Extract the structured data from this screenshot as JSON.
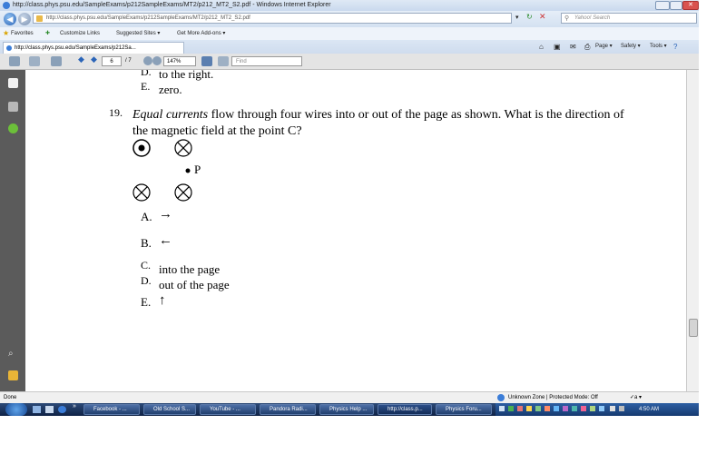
{
  "window": {
    "title": "http://class.phys.psu.edu/SampleExams/p212SampleExams/MT2/p212_MT2_S2.pdf - Windows Internet Explorer"
  },
  "address_bar": {
    "url": "http://class.phys.psu.edu/SampleExams/p212SampleExams/MT2/p212_MT2_S2.pdf"
  },
  "search": {
    "placeholder": "Yahoo! Search"
  },
  "favorites_bar": {
    "favorites_label": "Favorites",
    "items": [
      "Customize Links",
      "Suggested Sites ▾",
      "Get More Add-ons ▾"
    ]
  },
  "tab": {
    "label": "http://class.phys.psu.edu/SampleExams/p212Sa..."
  },
  "command_bar": {
    "page_label": "Page ▾",
    "safety_label": "Safety ▾",
    "tools_label": "Tools ▾"
  },
  "pdf_toolbar": {
    "page_number": "6",
    "page_total": "/ 7",
    "zoom": "147%",
    "find_placeholder": "Find"
  },
  "document": {
    "prev_d": "D.",
    "prev_d_text": "to the right.",
    "prev_e": "E.",
    "prev_e_text": "zero.",
    "q_number": "19.",
    "q_emph": "Equal currents",
    "q_line1": " flow through four wires into or out of the page as shown.  What is the direction of",
    "q_line2": "the magnetic field at the point C?",
    "point_label": "P",
    "options": [
      {
        "letter": "A.",
        "text": "→"
      },
      {
        "letter": "B.",
        "text": "←"
      },
      {
        "letter": "C.",
        "text": "into the page"
      },
      {
        "letter": "D.",
        "text": "out of the page"
      },
      {
        "letter": "E.",
        "text": "↑"
      }
    ]
  },
  "status_bar": {
    "left": "Done",
    "zone": "Unknown Zone | Protected Mode: Off",
    "zoom_label": "✓a ▾"
  },
  "taskbar": {
    "tasks": [
      "Facebook - ...",
      "Old School S...",
      "YouTube - ...",
      "Pandora Radi...",
      "Physics Help ...",
      "http://class.p...",
      "Physics Foru..."
    ],
    "clock": "4:50 AM"
  },
  "colors": {
    "titlebar": "#c9d9ee",
    "sidebar": "#5b5b5b",
    "taskbar": "#1a3260",
    "close_button": "#d9534f"
  }
}
